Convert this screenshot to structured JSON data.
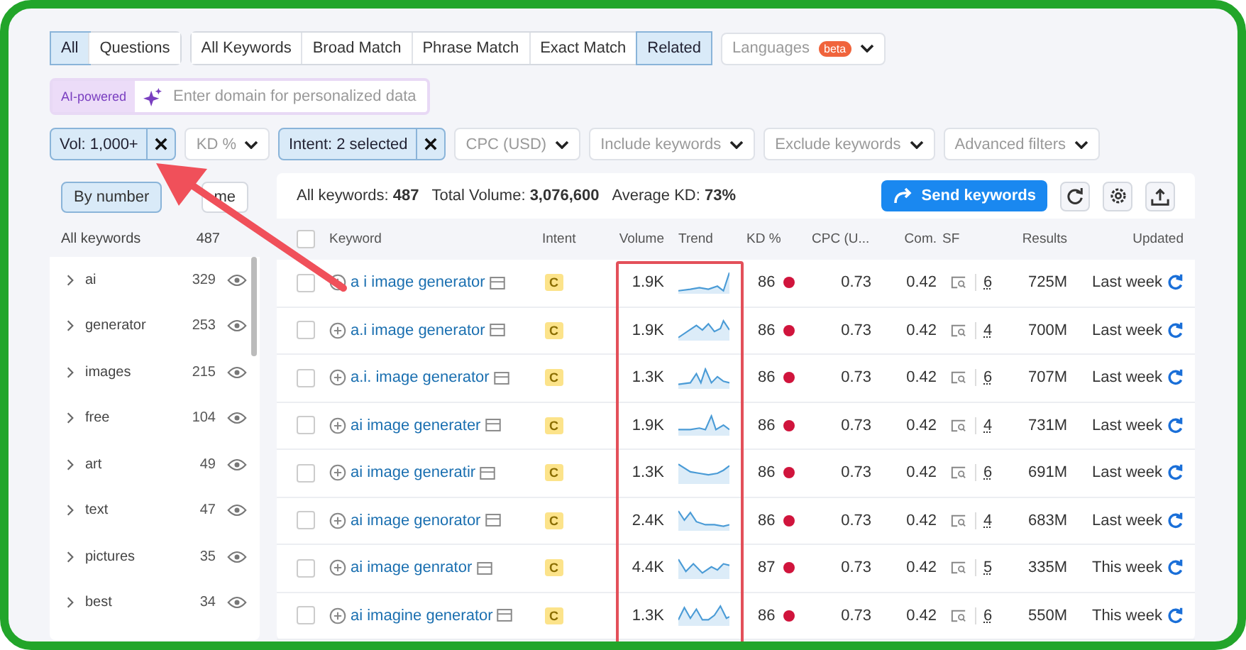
{
  "match_groups": [
    {
      "buttons": [
        {
          "label": "All",
          "selected": true
        },
        {
          "label": "Questions",
          "selected": false
        }
      ]
    },
    {
      "buttons": [
        {
          "label": "All Keywords",
          "selected": false
        },
        {
          "label": "Broad Match",
          "selected": false
        },
        {
          "label": "Phrase Match",
          "selected": false
        },
        {
          "label": "Exact Match",
          "selected": false
        },
        {
          "label": "Related",
          "selected": true
        }
      ]
    }
  ],
  "languages": {
    "label": "Languages",
    "badge": "beta"
  },
  "ai_field": {
    "badge": "AI-powered",
    "placeholder": "Enter domain for personalized data"
  },
  "filters": [
    {
      "label": "Vol: 1,000+",
      "active": true
    },
    {
      "label": "KD %",
      "active": false
    },
    {
      "label": "Intent: 2 selected",
      "active": true
    },
    {
      "label": "CPC (USD)",
      "active": false
    },
    {
      "label": "Include keywords",
      "active": false
    },
    {
      "label": "Exclude keywords",
      "active": false
    },
    {
      "label": "Advanced filters",
      "active": false
    }
  ],
  "sidebar": {
    "tabs": [
      {
        "label": "By number",
        "selected": true
      },
      {
        "label": "me",
        "selected": false
      }
    ],
    "header": {
      "label": "All keywords",
      "count": "487"
    },
    "groups": [
      {
        "label": "ai",
        "count": "329"
      },
      {
        "label": "generator",
        "count": "253"
      },
      {
        "label": "images",
        "count": "215"
      },
      {
        "label": "free",
        "count": "104"
      },
      {
        "label": "art",
        "count": "49"
      },
      {
        "label": "text",
        "count": "47"
      },
      {
        "label": "pictures",
        "count": "35"
      },
      {
        "label": "best",
        "count": "34"
      }
    ]
  },
  "summary": [
    "All keywords: **487**",
    "Total Volume: **3,076,600**",
    "Average KD: **73%**"
  ],
  "send_button": "Send keywords",
  "table": {
    "select_all_checked": false,
    "columns": [
      "Keyword",
      "Intent",
      "Volume",
      "Trend",
      "KD %",
      "CPC (U...",
      "Com.",
      "SF",
      "Results",
      "Updated"
    ],
    "rows": [
      {
        "checked": false,
        "keyword": "a i image generator",
        "intent": "C",
        "volume": "1.9K",
        "kd": "86",
        "cpc": "0.73",
        "com": "0.42",
        "sf": "6",
        "results": "725M",
        "updated": "Last week"
      },
      {
        "checked": false,
        "keyword": "a.i image generator",
        "intent": "C",
        "volume": "1.9K",
        "kd": "86",
        "cpc": "0.73",
        "com": "0.42",
        "sf": "4",
        "results": "700M",
        "updated": "Last week"
      },
      {
        "checked": false,
        "keyword": "a.i. image generator",
        "intent": "C",
        "volume": "1.3K",
        "kd": "86",
        "cpc": "0.73",
        "com": "0.42",
        "sf": "6",
        "results": "707M",
        "updated": "Last week"
      },
      {
        "checked": false,
        "keyword": "ai image generater",
        "intent": "C",
        "volume": "1.9K",
        "kd": "86",
        "cpc": "0.73",
        "com": "0.42",
        "sf": "4",
        "results": "731M",
        "updated": "Last week"
      },
      {
        "checked": false,
        "keyword": "ai image generatir",
        "intent": "C",
        "volume": "1.3K",
        "kd": "86",
        "cpc": "0.73",
        "com": "0.42",
        "sf": "6",
        "results": "691M",
        "updated": "Last week"
      },
      {
        "checked": false,
        "keyword": "ai image genorator",
        "intent": "C",
        "volume": "2.4K",
        "kd": "86",
        "cpc": "0.73",
        "com": "0.42",
        "sf": "4",
        "results": "683M",
        "updated": "Last week"
      },
      {
        "checked": false,
        "keyword": "ai image genrator",
        "intent": "C",
        "volume": "4.4K",
        "kd": "87",
        "cpc": "0.73",
        "com": "0.42",
        "sf": "5",
        "results": "335M",
        "updated": "This week"
      },
      {
        "checked": false,
        "keyword": "ai imagine generator",
        "intent": "C",
        "volume": "1.3K",
        "kd": "86",
        "cpc": "0.73",
        "com": "0.42",
        "sf": "6",
        "results": "550M",
        "updated": "This week"
      }
    ]
  }
}
